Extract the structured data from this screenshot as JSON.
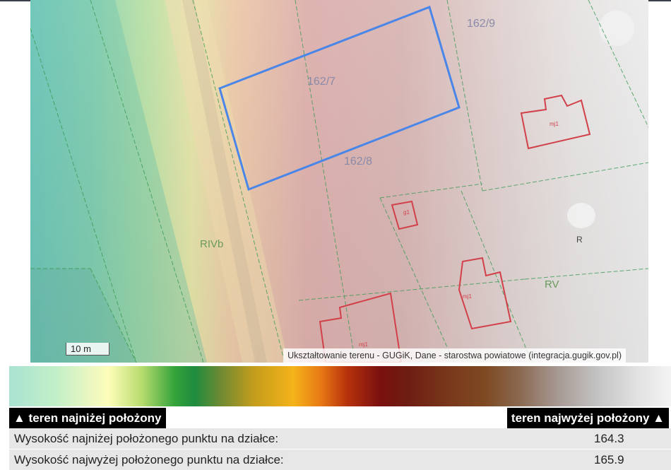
{
  "map": {
    "scale_label": "10 m",
    "attribution": "Ukształtowanie terenu - GUGiK, Dane - starostwa powiatowe (integracja.gugik.gov.pl)",
    "parcel_labels": [
      "162/7",
      "162/8",
      "162/9"
    ],
    "landuse_labels": [
      "RIVb",
      "RV",
      "R"
    ],
    "building_labels": [
      "mj1",
      "mj1",
      "mj1",
      "g1"
    ],
    "highlight_color": "#4a86e8",
    "building_color": "#d2404a",
    "boundary_color": "#3a9a55"
  },
  "legend": {
    "low_label": "▲ teren najniżej położony",
    "high_label": "teren najwyżej położony ▲"
  },
  "stats": [
    {
      "label": "Wysokość najniżej położonego punktu na działce:",
      "value": "164.3"
    },
    {
      "label": "Wysokość najwyżej położonego punktu na działce:",
      "value": "165.9"
    }
  ]
}
